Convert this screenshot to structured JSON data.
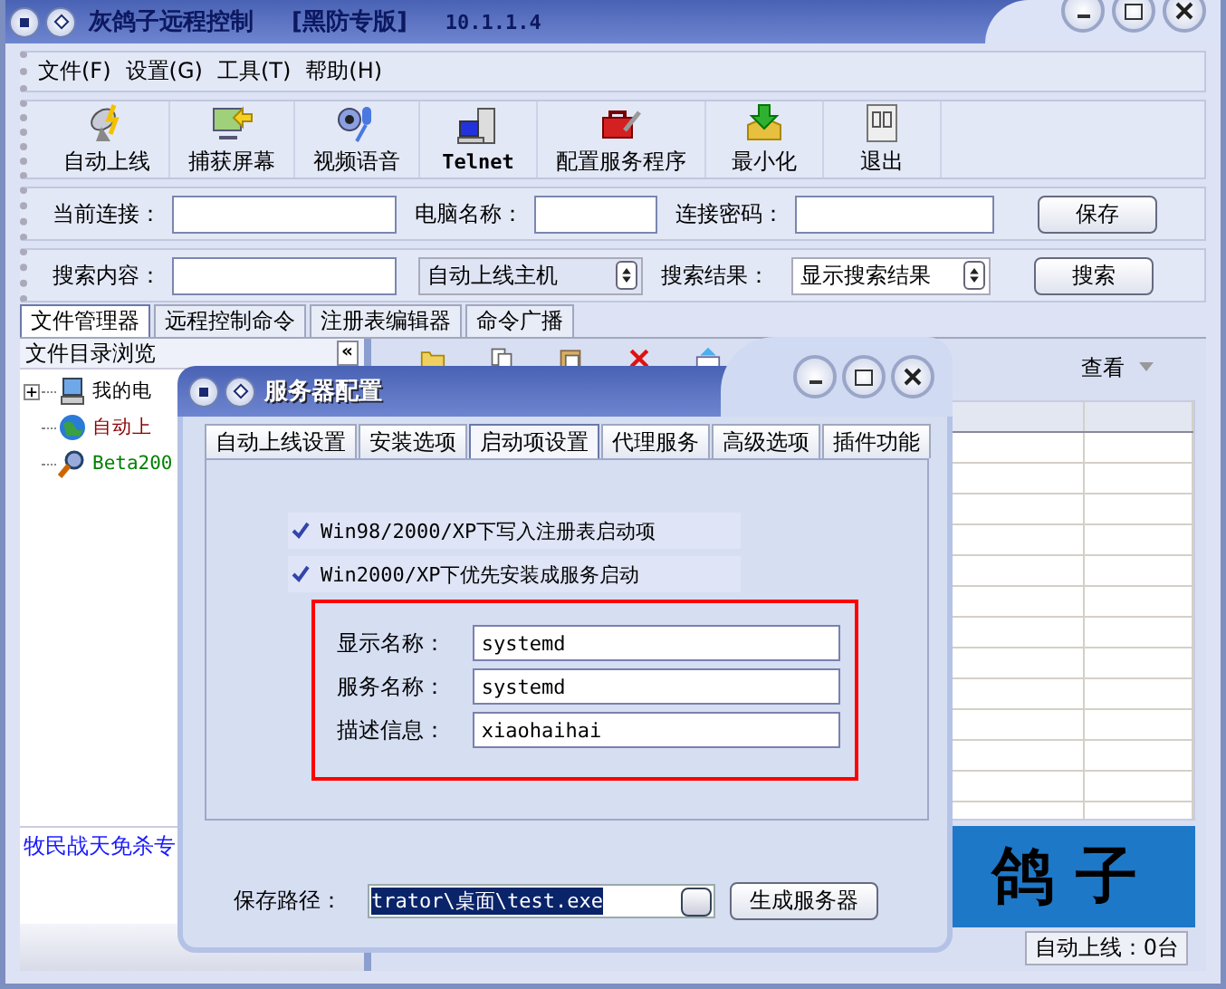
{
  "window": {
    "title": "灰鸽子远程控制",
    "edition": "[黑防专版]",
    "version": "10.1.1.4"
  },
  "menu": [
    "文件(F)",
    "设置(G)",
    "工具(T)",
    "帮助(H)"
  ],
  "toolbar": [
    {
      "label": "自动上线",
      "kind": "satellite"
    },
    {
      "label": "捕获屏幕",
      "kind": "screen"
    },
    {
      "label": "视频语音",
      "kind": "microphone"
    },
    {
      "label": "Telnet",
      "kind": "computer"
    },
    {
      "label": "配置服务程序",
      "kind": "toolbox"
    },
    {
      "label": "最小化",
      "kind": "download"
    },
    {
      "label": "退出",
      "kind": "exit"
    }
  ],
  "connection": {
    "fields": [
      {
        "label": "当前连接："
      },
      {
        "label": "电脑名称："
      },
      {
        "label": "连接密码："
      }
    ],
    "button": "保存"
  },
  "search": {
    "label": "搜索内容：",
    "scope": "自动上线主机",
    "result_label": "搜索结果：",
    "result": "显示搜索结果",
    "button": "搜索"
  },
  "tabs": [
    {
      "label": "文件管理器",
      "selected": true
    },
    {
      "label": "远程控制命令",
      "selected": false
    },
    {
      "label": "注册表编辑器",
      "selected": false
    },
    {
      "label": "命令广播",
      "selected": false
    }
  ],
  "file_panel": {
    "title": "文件目录浏览",
    "collapse": "«",
    "tree": [
      {
        "label": "我的电",
        "kind": "computer",
        "color": "#000000",
        "has_children": true
      },
      {
        "label": "自动上",
        "kind": "globe",
        "color": "#8b0000",
        "has_children": false
      },
      {
        "label": "Beta200",
        "kind": "search",
        "color": "#008000",
        "has_children": false
      }
    ]
  },
  "notice": "牧民战天免杀专",
  "list_toolbar": {
    "view_label": "查看"
  },
  "logo": "鸽子",
  "status": "自动上线：0台",
  "dialog": {
    "title": "服务器配置",
    "tabs": [
      {
        "label": "自动上线设置",
        "selected": false
      },
      {
        "label": "安装选项",
        "selected": false
      },
      {
        "label": "启动项设置",
        "selected": true
      },
      {
        "label": "代理服务",
        "selected": false
      },
      {
        "label": "高级选项",
        "selected": false
      },
      {
        "label": "插件功能",
        "selected": false
      }
    ],
    "options": [
      {
        "label": "Win98/2000/XP下写入注册表启动项",
        "checked": true
      },
      {
        "label": "Win2000/XP下优先安装成服务启动",
        "checked": true
      }
    ],
    "fields": [
      {
        "label": "显示名称：",
        "value": "systemd"
      },
      {
        "label": "服务名称：",
        "value": "systemd"
      },
      {
        "label": "描述信息：",
        "value": "xiaohaihai"
      }
    ],
    "save_path": {
      "label": "保存路径：",
      "value": "trator\\桌面\\test.exe"
    },
    "button": "生成服务器"
  }
}
